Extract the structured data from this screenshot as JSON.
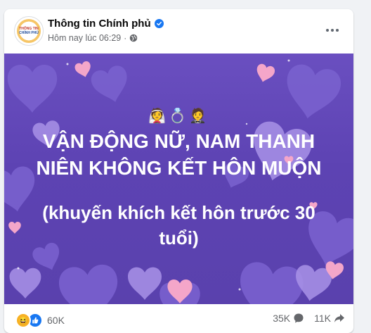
{
  "post": {
    "page_name": "Thông tin Chính phủ",
    "avatar_line1": "THÔNG TIN",
    "avatar_line2": "CHÍNH PHỦ",
    "timestamp": "Hôm nay lúc 06:29",
    "separator": "·",
    "privacy_icon": "globe-icon",
    "verified_icon": "verified-badge-icon",
    "more_icon": "more-options-icon"
  },
  "banner": {
    "background_color": "#5d43b3",
    "emojis": "👰💍🤵",
    "headline": "VẬN ĐỘNG NỮ, NAM THANH NIÊN KHÔNG KẾT HÔN MUỘN",
    "subline": "(khuyến khích kết hôn trước 30 tuổi)"
  },
  "footer": {
    "reaction_icons": [
      "haha-icon",
      "like-icon"
    ],
    "reaction_count": "60K",
    "comment_count": "35K",
    "comment_icon": "comment-icon",
    "share_count": "11K",
    "share_icon": "share-icon"
  }
}
